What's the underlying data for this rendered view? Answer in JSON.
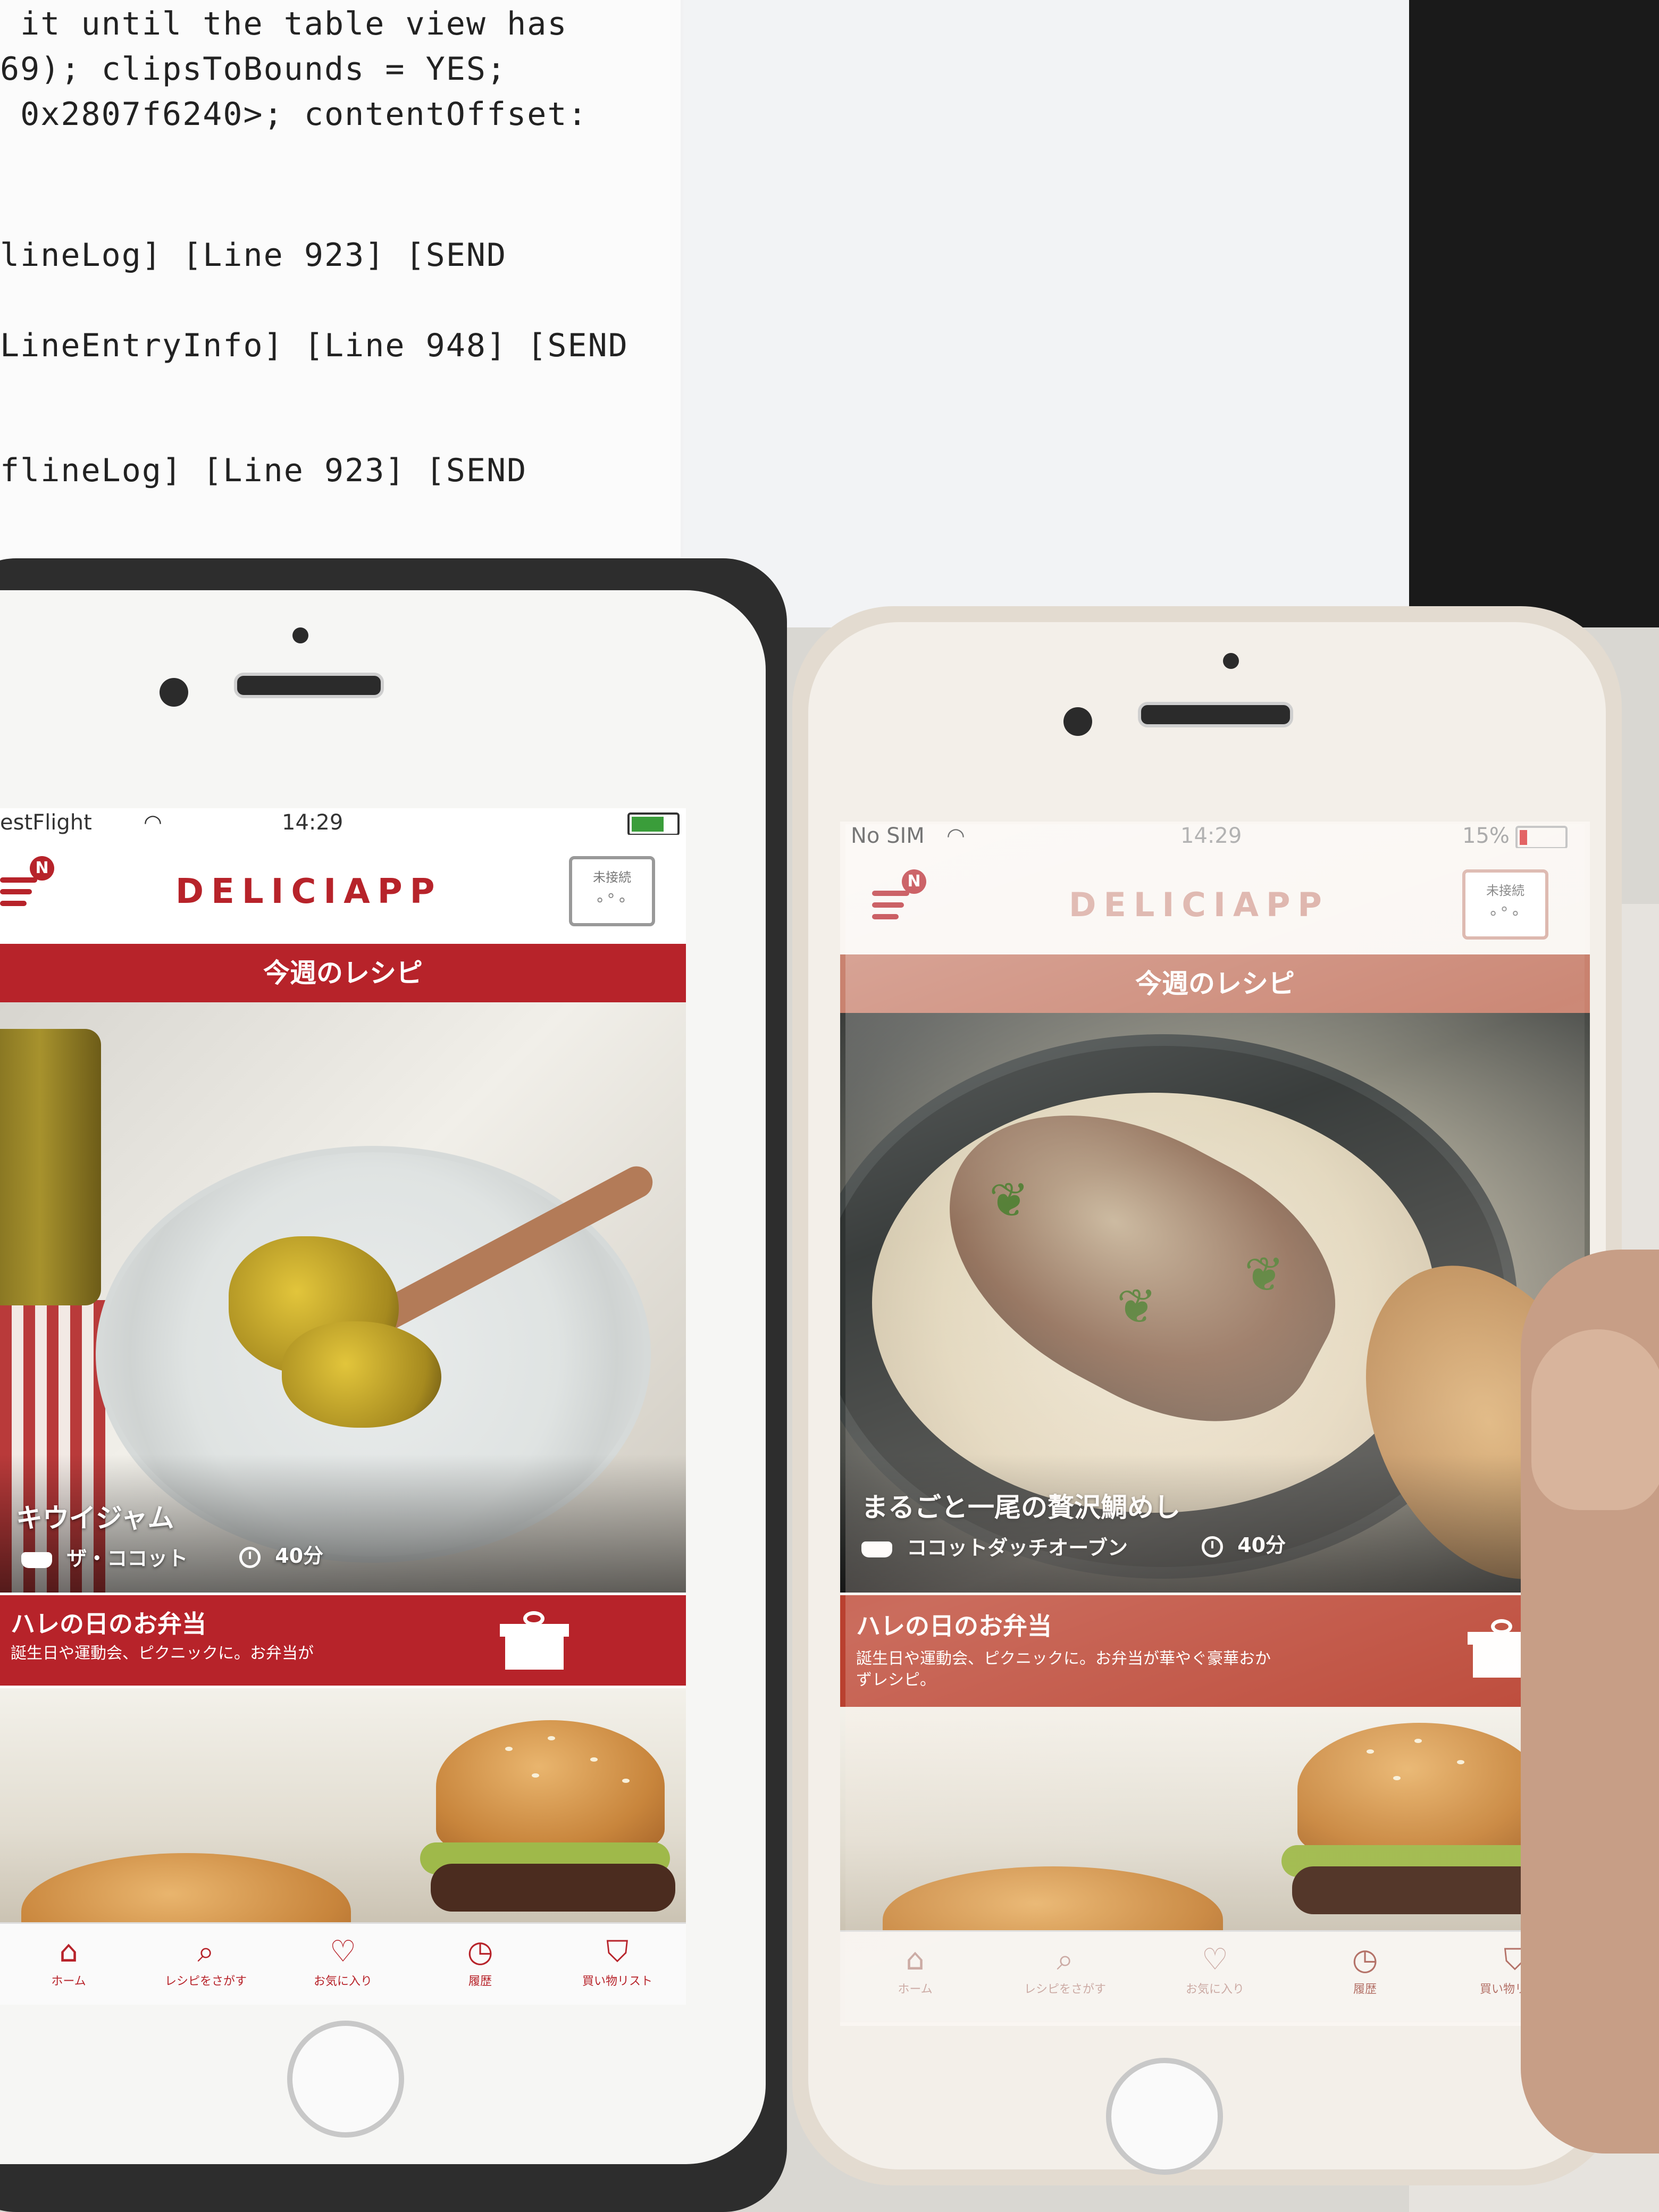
{
  "console": {
    "lines": [
      " it until the table view has",
      "69); clipsToBounds = YES;",
      " 0x2807f6240>; contentOffset:",
      "",
      "",
      "lineLog] [Line 923] [SEND",
      "",
      "LineEntryInfo] [Line 948] [SEND",
      "",
      "",
      "flineLog] [Line 923] [SEND"
    ]
  },
  "phone_left": {
    "status": {
      "carrier": "estFlight",
      "time": "14:29"
    },
    "logo": "DELICIAPP",
    "device_status_label": "未接続",
    "section_banner": "今週のレシピ",
    "recipe": {
      "title": "キウイジャム",
      "cookware": "ザ・ココット",
      "time": "40分"
    },
    "promo": {
      "title": "ハレの日のお弁当",
      "description": "誕生日や運動会、ピクニックに。お弁当が"
    },
    "tabs": [
      "ホーム",
      "レシピをさがす",
      "お気に入り",
      "履歴",
      "買い物リスト"
    ]
  },
  "phone_right": {
    "status": {
      "carrier": "No SIM",
      "time": "14:29",
      "battery": "15%"
    },
    "logo": "DELICIAPP",
    "device_status_label": "未接続",
    "section_banner": "今週のレシピ",
    "recipe": {
      "title": "まるごと一尾の贅沢鯛めし",
      "cookware": "ココットダッチオーブン",
      "time": "40分"
    },
    "promo": {
      "title": "ハレの日のお弁当",
      "description": "誕生日や運動会、ピクニックに。お弁当が華やぐ豪華おかずレシピ。"
    },
    "tabs": [
      "ホーム",
      "レシピをさがす",
      "お気に入り",
      "履歴",
      "買い物リスト"
    ]
  },
  "colors": {
    "brand_red": "#b7232a",
    "case": "#2d2d2d"
  },
  "icons": [
    "menu-icon",
    "notification-badge-icon",
    "device-status-icon",
    "cookware-pot-icon",
    "clock-icon",
    "gift-icon",
    "home-icon",
    "search-icon",
    "heart-icon",
    "history-icon",
    "basket-icon",
    "wifi-icon",
    "battery-icon"
  ]
}
